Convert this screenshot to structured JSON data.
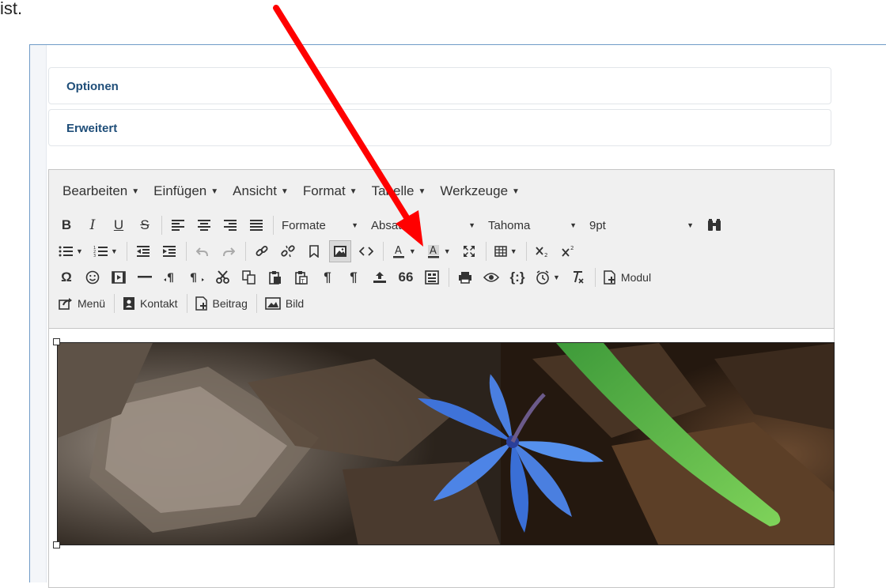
{
  "top_text": "ist.",
  "panels": {
    "options": "Optionen",
    "advanced": "Erweitert"
  },
  "menubar": {
    "edit": "Bearbeiten",
    "insert": "Einfügen",
    "view": "Ansicht",
    "format": "Format",
    "table": "Tabelle",
    "tools": "Werkzeuge"
  },
  "toolbar": {
    "bold": "B",
    "italic": "I",
    "underline": "U",
    "strike": "S",
    "formats_dropdown": "Formate",
    "block_dropdown": "Absatz",
    "font_dropdown": "Tahoma",
    "size_dropdown": "9pt",
    "omega": "Ω",
    "nbsp": "¶",
    "quote": "66",
    "code_sample": "{:}",
    "module_label": "Modul",
    "menu_label": "Menü",
    "contact_label": "Kontakt",
    "article_label": "Beitrag",
    "image_label": "Bild"
  },
  "colors": {
    "arrow": "#ff0000",
    "panel_link": "#1f4e79",
    "toolbar_bg": "#f0f0f0",
    "frame_border": "#6f9bc7"
  }
}
